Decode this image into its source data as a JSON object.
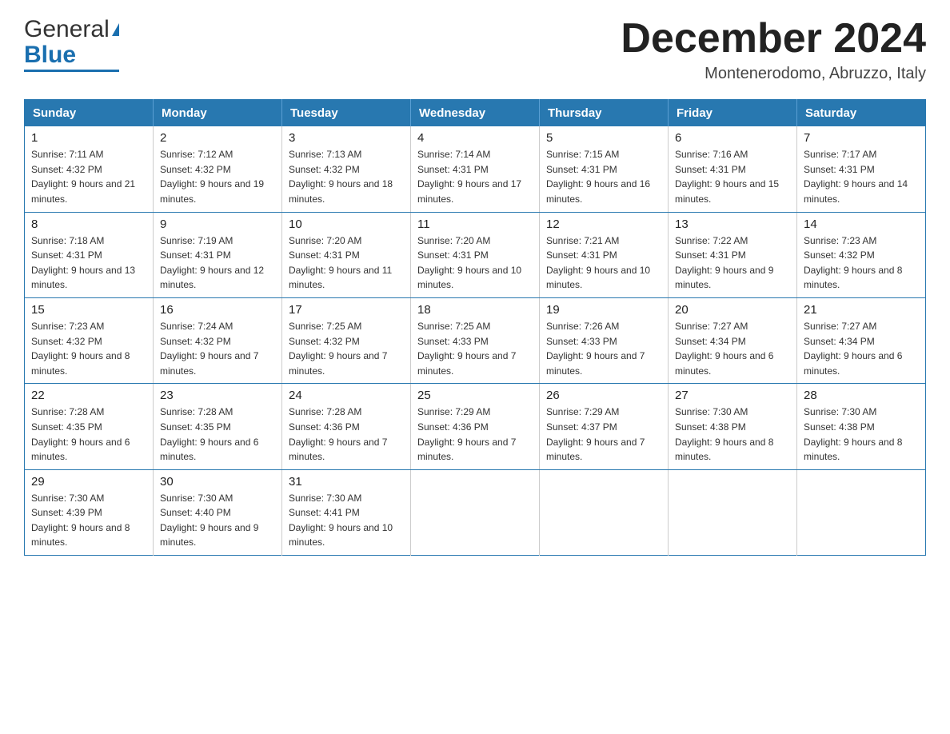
{
  "logo": {
    "text_general": "General",
    "triangle": "▲",
    "text_blue": "Blue"
  },
  "title": "December 2024",
  "location": "Montenerodomo, Abruzzo, Italy",
  "days_of_week": [
    "Sunday",
    "Monday",
    "Tuesday",
    "Wednesday",
    "Thursday",
    "Friday",
    "Saturday"
  ],
  "weeks": [
    [
      {
        "day": "1",
        "sunrise": "7:11 AM",
        "sunset": "4:32 PM",
        "daylight": "9 hours and 21 minutes."
      },
      {
        "day": "2",
        "sunrise": "7:12 AM",
        "sunset": "4:32 PM",
        "daylight": "9 hours and 19 minutes."
      },
      {
        "day": "3",
        "sunrise": "7:13 AM",
        "sunset": "4:32 PM",
        "daylight": "9 hours and 18 minutes."
      },
      {
        "day": "4",
        "sunrise": "7:14 AM",
        "sunset": "4:31 PM",
        "daylight": "9 hours and 17 minutes."
      },
      {
        "day": "5",
        "sunrise": "7:15 AM",
        "sunset": "4:31 PM",
        "daylight": "9 hours and 16 minutes."
      },
      {
        "day": "6",
        "sunrise": "7:16 AM",
        "sunset": "4:31 PM",
        "daylight": "9 hours and 15 minutes."
      },
      {
        "day": "7",
        "sunrise": "7:17 AM",
        "sunset": "4:31 PM",
        "daylight": "9 hours and 14 minutes."
      }
    ],
    [
      {
        "day": "8",
        "sunrise": "7:18 AM",
        "sunset": "4:31 PM",
        "daylight": "9 hours and 13 minutes."
      },
      {
        "day": "9",
        "sunrise": "7:19 AM",
        "sunset": "4:31 PM",
        "daylight": "9 hours and 12 minutes."
      },
      {
        "day": "10",
        "sunrise": "7:20 AM",
        "sunset": "4:31 PM",
        "daylight": "9 hours and 11 minutes."
      },
      {
        "day": "11",
        "sunrise": "7:20 AM",
        "sunset": "4:31 PM",
        "daylight": "9 hours and 10 minutes."
      },
      {
        "day": "12",
        "sunrise": "7:21 AM",
        "sunset": "4:31 PM",
        "daylight": "9 hours and 10 minutes."
      },
      {
        "day": "13",
        "sunrise": "7:22 AM",
        "sunset": "4:31 PM",
        "daylight": "9 hours and 9 minutes."
      },
      {
        "day": "14",
        "sunrise": "7:23 AM",
        "sunset": "4:32 PM",
        "daylight": "9 hours and 8 minutes."
      }
    ],
    [
      {
        "day": "15",
        "sunrise": "7:23 AM",
        "sunset": "4:32 PM",
        "daylight": "9 hours and 8 minutes."
      },
      {
        "day": "16",
        "sunrise": "7:24 AM",
        "sunset": "4:32 PM",
        "daylight": "9 hours and 7 minutes."
      },
      {
        "day": "17",
        "sunrise": "7:25 AM",
        "sunset": "4:32 PM",
        "daylight": "9 hours and 7 minutes."
      },
      {
        "day": "18",
        "sunrise": "7:25 AM",
        "sunset": "4:33 PM",
        "daylight": "9 hours and 7 minutes."
      },
      {
        "day": "19",
        "sunrise": "7:26 AM",
        "sunset": "4:33 PM",
        "daylight": "9 hours and 7 minutes."
      },
      {
        "day": "20",
        "sunrise": "7:27 AM",
        "sunset": "4:34 PM",
        "daylight": "9 hours and 6 minutes."
      },
      {
        "day": "21",
        "sunrise": "7:27 AM",
        "sunset": "4:34 PM",
        "daylight": "9 hours and 6 minutes."
      }
    ],
    [
      {
        "day": "22",
        "sunrise": "7:28 AM",
        "sunset": "4:35 PM",
        "daylight": "9 hours and 6 minutes."
      },
      {
        "day": "23",
        "sunrise": "7:28 AM",
        "sunset": "4:35 PM",
        "daylight": "9 hours and 6 minutes."
      },
      {
        "day": "24",
        "sunrise": "7:28 AM",
        "sunset": "4:36 PM",
        "daylight": "9 hours and 7 minutes."
      },
      {
        "day": "25",
        "sunrise": "7:29 AM",
        "sunset": "4:36 PM",
        "daylight": "9 hours and 7 minutes."
      },
      {
        "day": "26",
        "sunrise": "7:29 AM",
        "sunset": "4:37 PM",
        "daylight": "9 hours and 7 minutes."
      },
      {
        "day": "27",
        "sunrise": "7:30 AM",
        "sunset": "4:38 PM",
        "daylight": "9 hours and 8 minutes."
      },
      {
        "day": "28",
        "sunrise": "7:30 AM",
        "sunset": "4:38 PM",
        "daylight": "9 hours and 8 minutes."
      }
    ],
    [
      {
        "day": "29",
        "sunrise": "7:30 AM",
        "sunset": "4:39 PM",
        "daylight": "9 hours and 8 minutes."
      },
      {
        "day": "30",
        "sunrise": "7:30 AM",
        "sunset": "4:40 PM",
        "daylight": "9 hours and 9 minutes."
      },
      {
        "day": "31",
        "sunrise": "7:30 AM",
        "sunset": "4:41 PM",
        "daylight": "9 hours and 10 minutes."
      },
      null,
      null,
      null,
      null
    ]
  ]
}
